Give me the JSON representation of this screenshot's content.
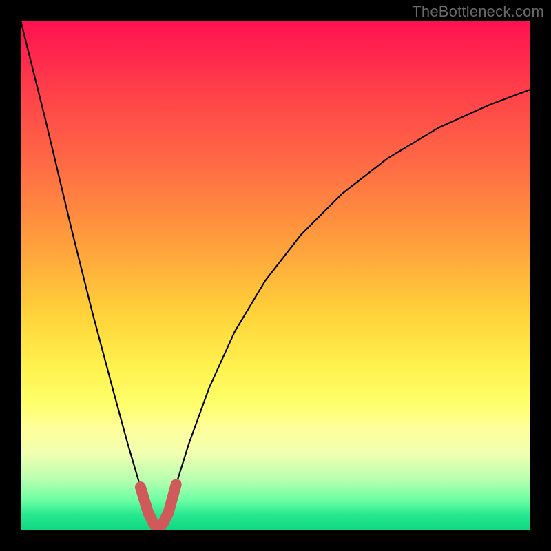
{
  "watermark": "TheBottleneck.com",
  "chart_data": {
    "type": "line",
    "title": "",
    "xlabel": "",
    "ylabel": "",
    "xlim": [
      0,
      1
    ],
    "ylim": [
      0,
      1
    ],
    "note": "Bottleneck curve — sharp V-minimum near x≈0.27 on a red-to-green gradient background; no numeric axes shown.",
    "series": [
      {
        "name": "bottleneck-curve",
        "x": [
          0.0,
          0.05,
          0.1,
          0.14,
          0.18,
          0.21,
          0.235,
          0.25,
          0.26,
          0.27,
          0.28,
          0.29,
          0.305,
          0.33,
          0.37,
          0.42,
          0.48,
          0.55,
          0.63,
          0.72,
          0.82,
          0.92,
          1.0
        ],
        "y": [
          1.0,
          0.8,
          0.59,
          0.43,
          0.28,
          0.17,
          0.085,
          0.035,
          0.015,
          0.0,
          0.015,
          0.035,
          0.09,
          0.17,
          0.28,
          0.39,
          0.49,
          0.58,
          0.66,
          0.73,
          0.79,
          0.835,
          0.865
        ]
      }
    ],
    "highlight": {
      "name": "min-region",
      "color": "#d05a5a",
      "x": [
        0.235,
        0.25,
        0.26,
        0.27,
        0.28,
        0.29,
        0.305
      ],
      "y": [
        0.085,
        0.035,
        0.015,
        0.0,
        0.015,
        0.035,
        0.09
      ]
    }
  }
}
